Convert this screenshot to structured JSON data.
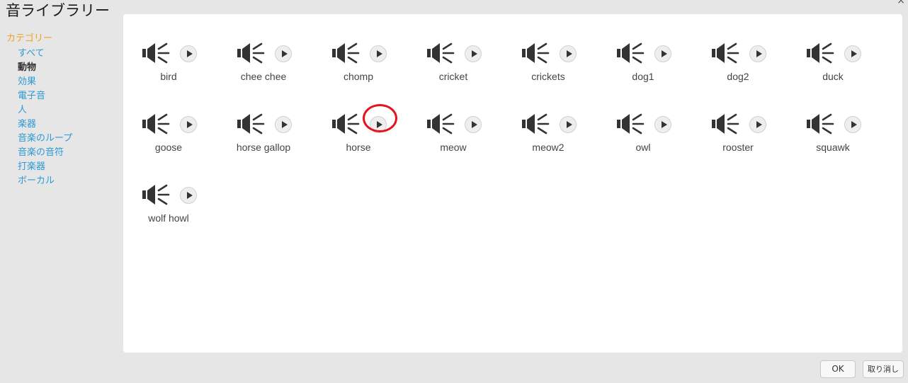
{
  "dialog": {
    "title": "音ライブラリー",
    "close_glyph": "×"
  },
  "sidebar": {
    "header": "カテゴリー",
    "categories": [
      {
        "label": "すべて",
        "selected": false
      },
      {
        "label": "動物",
        "selected": true
      },
      {
        "label": "効果",
        "selected": false
      },
      {
        "label": "電子音",
        "selected": false
      },
      {
        "label": "人",
        "selected": false
      },
      {
        "label": "楽器",
        "selected": false
      },
      {
        "label": "音楽のループ",
        "selected": false
      },
      {
        "label": "音楽の音符",
        "selected": false
      },
      {
        "label": "打楽器",
        "selected": false
      },
      {
        "label": "ボーカル",
        "selected": false
      }
    ]
  },
  "sounds": [
    {
      "name": "bird"
    },
    {
      "name": "chee chee"
    },
    {
      "name": "chomp"
    },
    {
      "name": "cricket"
    },
    {
      "name": "crickets"
    },
    {
      "name": "dog1"
    },
    {
      "name": "dog2"
    },
    {
      "name": "duck"
    },
    {
      "name": "goose"
    },
    {
      "name": "horse gallop"
    },
    {
      "name": "horse"
    },
    {
      "name": "meow"
    },
    {
      "name": "meow2"
    },
    {
      "name": "owl"
    },
    {
      "name": "rooster"
    },
    {
      "name": "squawk"
    },
    {
      "name": "wolf howl"
    }
  ],
  "icons": {
    "sound": "speaker-icon",
    "play": "play-icon"
  },
  "highlighted_play_button": "horse",
  "colors": {
    "accent": "#2d9ad6",
    "category_header": "#f0a020",
    "highlight": "#e5131d"
  },
  "buttons": {
    "ok": "OK",
    "cancel": "取り消し"
  }
}
